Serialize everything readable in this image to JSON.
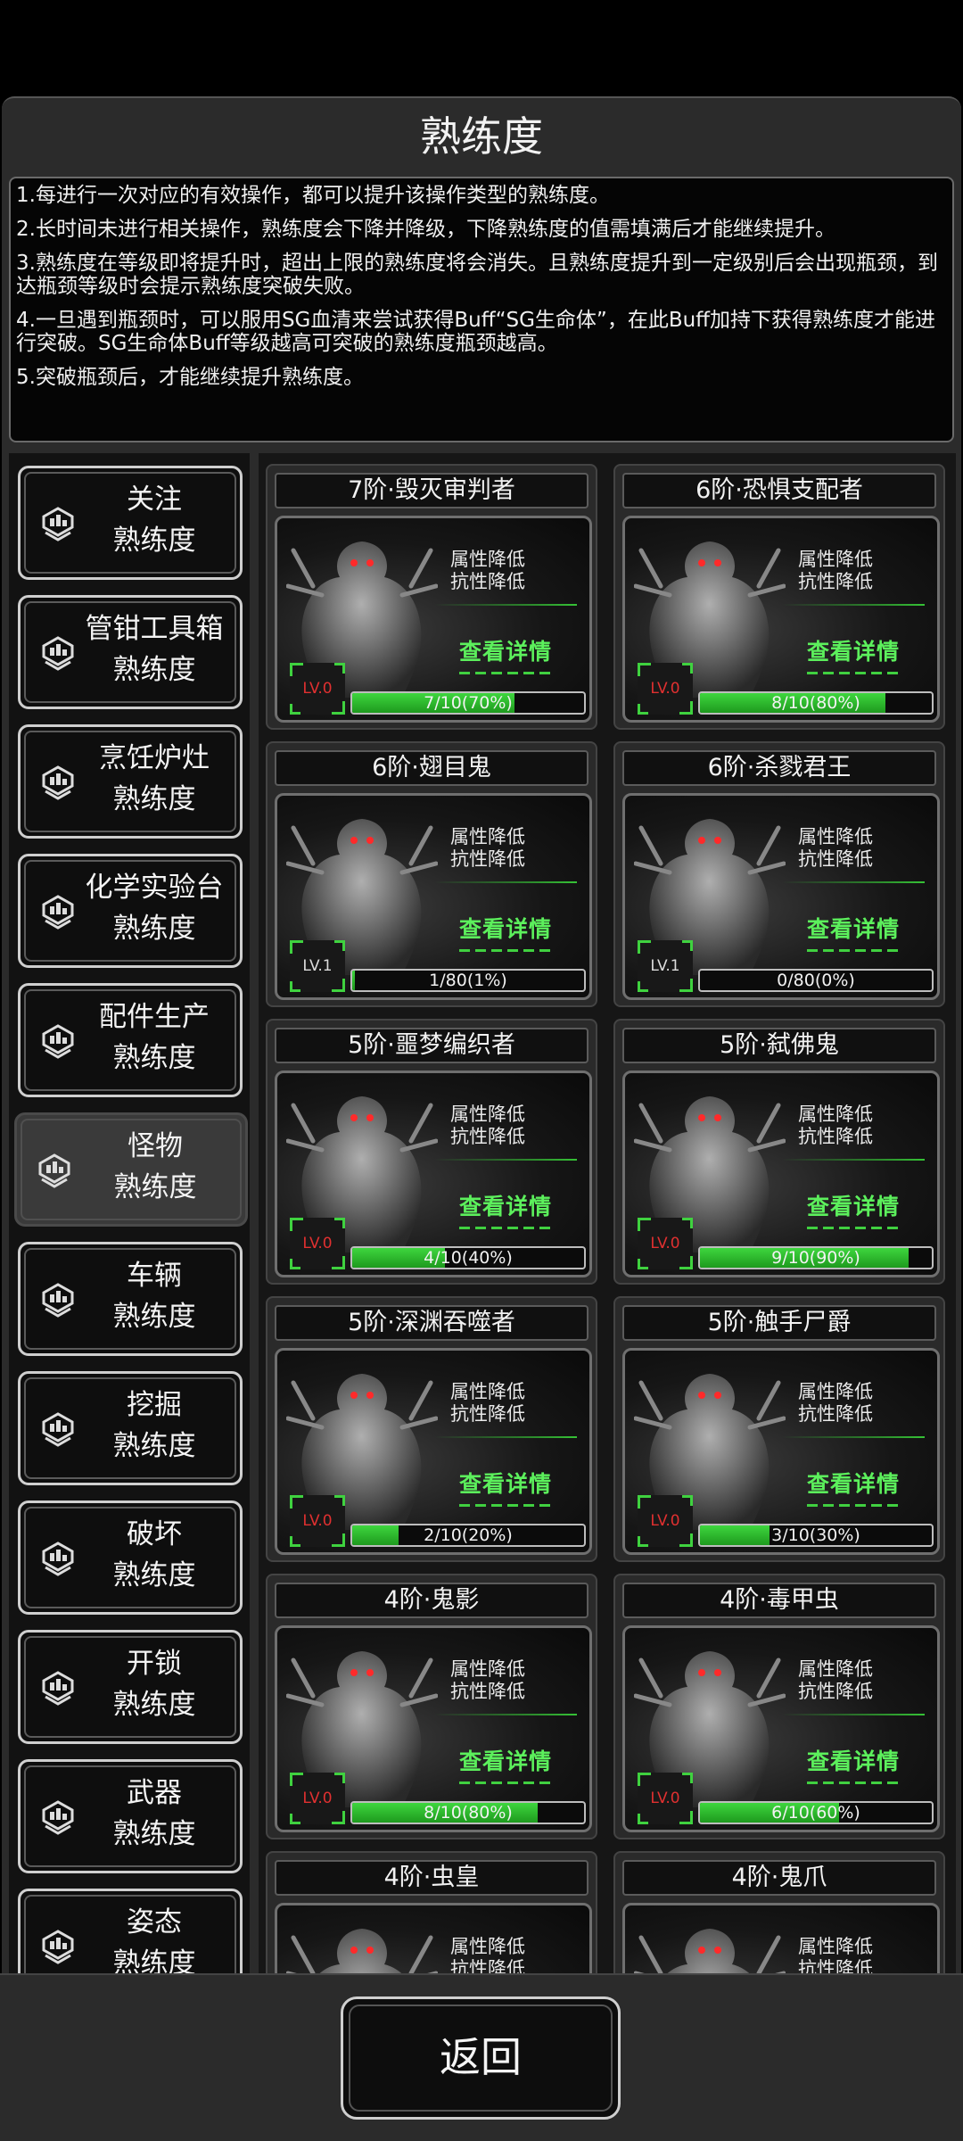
{
  "title": "熟练度",
  "rules": [
    "1.每进行一次对应的有效操作，都可以提升该操作类型的熟练度。",
    "2.长时间未进行相关操作，熟练度会下降并降级，下降熟练度的值需填满后才能继续提升。",
    "3.熟练度在等级即将提升时，超出上限的熟练度将会消失。且熟练度提升到一定级别后会出现瓶颈，到达瓶颈等级时会提示熟练度突破失败。",
    "4.一旦遇到瓶颈时，可以服用SG血清来尝试获得Buff“SG生命体”，在此Buff加持下获得熟练度才能进行突破。SG生命体Buff等级越高可突破的熟练度瓶颈越高。",
    "5.突破瓶颈后，才能继续提升熟练度。"
  ],
  "sidebar": [
    {
      "line1": "关注",
      "line2": "熟练度",
      "active": false
    },
    {
      "line1": "管钳工具箱",
      "line2": "熟练度",
      "active": false
    },
    {
      "line1": "烹饪炉灶",
      "line2": "熟练度",
      "active": false
    },
    {
      "line1": "化学实验台",
      "line2": "熟练度",
      "active": false
    },
    {
      "line1": "配件生产",
      "line2": "熟练度",
      "active": false
    },
    {
      "line1": "怪物",
      "line2": "熟练度",
      "active": true
    },
    {
      "line1": "车辆",
      "line2": "熟练度",
      "active": false
    },
    {
      "line1": "挖掘",
      "line2": "熟练度",
      "active": false
    },
    {
      "line1": "破坏",
      "line2": "熟练度",
      "active": false
    },
    {
      "line1": "开锁",
      "line2": "熟练度",
      "active": false
    },
    {
      "line1": "武器",
      "line2": "熟练度",
      "active": false
    },
    {
      "line1": "姿态",
      "line2": "熟练度",
      "active": false
    }
  ],
  "card_common": {
    "attr1": "属性降低",
    "attr2": "抗性降低",
    "detail": "查看详情"
  },
  "cards": [
    {
      "name": "7阶·毁灭审判者",
      "level": "LV.0",
      "progress": "7/10(70%)",
      "fraction": 0.7,
      "lv_color": "red"
    },
    {
      "name": "6阶·恐惧支配者",
      "level": "LV.0",
      "progress": "8/10(80%)",
      "fraction": 0.8,
      "lv_color": "red"
    },
    {
      "name": "6阶·翅目鬼",
      "level": "LV.1",
      "progress": "1/80(1%)",
      "fraction": 0.01,
      "lv_color": "white"
    },
    {
      "name": "6阶·杀戮君王",
      "level": "LV.1",
      "progress": "0/80(0%)",
      "fraction": 0.0,
      "lv_color": "white"
    },
    {
      "name": "5阶·噩梦编织者",
      "level": "LV.0",
      "progress": "4/10(40%)",
      "fraction": 0.4,
      "lv_color": "red"
    },
    {
      "name": "5阶·弑佛鬼",
      "level": "LV.0",
      "progress": "9/10(90%)",
      "fraction": 0.9,
      "lv_color": "red"
    },
    {
      "name": "5阶·深渊吞噬者",
      "level": "LV.0",
      "progress": "2/10(20%)",
      "fraction": 0.2,
      "lv_color": "red"
    },
    {
      "name": "5阶·触手尸爵",
      "level": "LV.0",
      "progress": "3/10(30%)",
      "fraction": 0.3,
      "lv_color": "red"
    },
    {
      "name": "4阶·鬼影",
      "level": "LV.0",
      "progress": "8/10(80%)",
      "fraction": 0.8,
      "lv_color": "red"
    },
    {
      "name": "4阶·毒甲虫",
      "level": "LV.0",
      "progress": "6/10(60%)",
      "fraction": 0.6,
      "lv_color": "red"
    },
    {
      "name": "4阶·虫皇",
      "level": "",
      "progress": "",
      "fraction": 0.0,
      "lv_color": "red"
    },
    {
      "name": "4阶·鬼爪",
      "level": "",
      "progress": "",
      "fraction": 0.0,
      "lv_color": "red"
    }
  ],
  "back_button": "返回"
}
